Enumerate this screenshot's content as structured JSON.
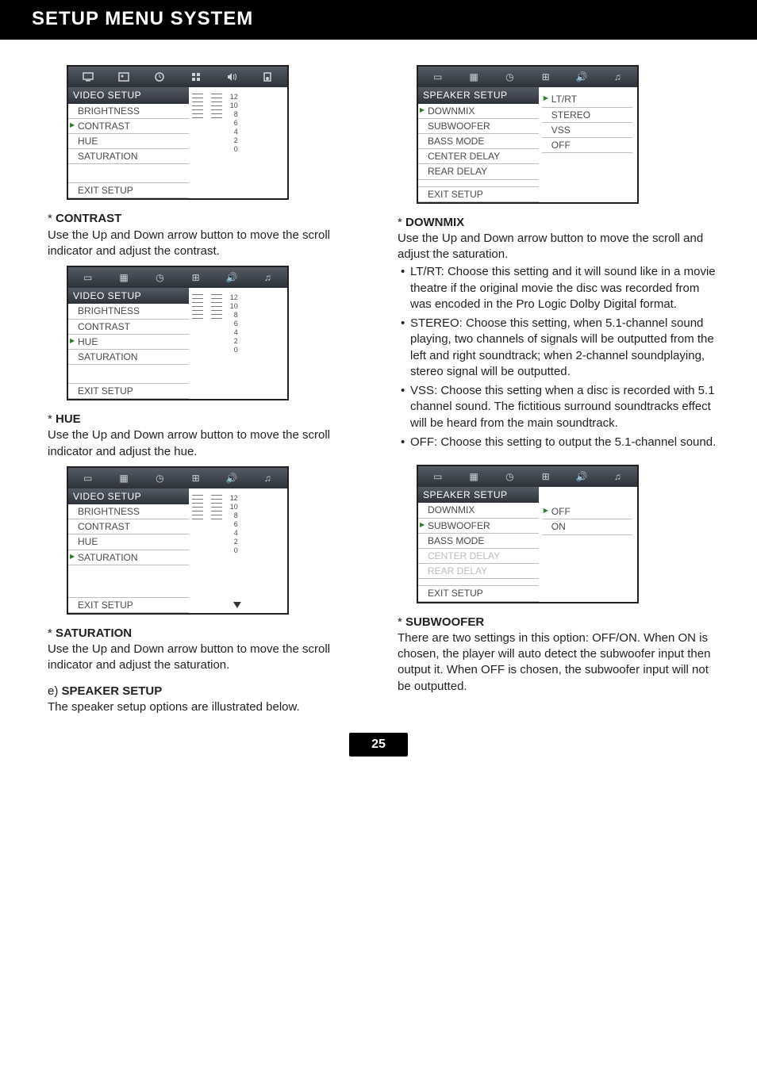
{
  "header": {
    "title": "SETUP MENU SYSTEM"
  },
  "page_number": "25",
  "video_setup": {
    "title": "VIDEO SETUP",
    "items": [
      "BRIGHTNESS",
      "CONTRAST",
      "HUE",
      "SATURATION"
    ],
    "exit": "EXIT SETUP",
    "scale": [
      "12",
      "10",
      "8",
      "6",
      "4",
      "2",
      "0"
    ]
  },
  "speaker_setup_a": {
    "title": "SPEAKER SETUP",
    "items": [
      "DOWNMIX",
      "SUBWOOFER",
      "BASS MODE",
      "CENTER DELAY",
      "REAR DELAY"
    ],
    "exit": "EXIT SETUP",
    "options": [
      "LT/RT",
      "STEREO",
      "VSS",
      "OFF"
    ]
  },
  "speaker_setup_b": {
    "title": "SPEAKER SETUP",
    "items": [
      "DOWNMIX",
      "SUBWOOFER",
      "BASS MODE",
      "CENTER DELAY",
      "REAR DELAY"
    ],
    "exit": "EXIT SETUP",
    "options": [
      "OFF",
      "ON"
    ]
  },
  "left": {
    "contrast_head": "CONTRAST",
    "contrast_body": "Use the Up and Down arrow button to move the scroll indicator and adjust the contrast.",
    "hue_head": "HUE",
    "hue_body": "Use the Up and Down arrow button to move the scroll indicator and adjust the hue.",
    "sat_head": "SATURATION",
    "sat_body": "Use the Up and Down arrow button to move the scroll indicator and adjust the saturation.",
    "speaker_head_prefix": "e) ",
    "speaker_head": "SPEAKER SETUP",
    "speaker_body": "The speaker setup options are illustrated below."
  },
  "right": {
    "downmix_head": "DOWNMIX",
    "downmix_body": "Use the Up and Down arrow button to move the scroll and adjust the saturation.",
    "lt": "LT/RT: Choose this setting and it will sound like in a movie theatre if the original movie the disc was recorded from was encoded in the Pro Logic Dolby Digital format.",
    "stereo": "STEREO: Choose this setting, when 5.1-channel sound playing, two channels of signals will be outputted from the left and right soundtrack; when 2-channel soundplaying, stereo signal will be outputted.",
    "vss": "VSS: Choose this setting when a disc is recorded with 5.1 channel sound. The fictitious surround soundtracks effect will be heard from the main soundtrack.",
    "off": "OFF: Choose this setting to output the 5.1-channel sound.",
    "sub_head": "SUBWOOFER",
    "sub_body": "There are two settings in this option: OFF/ON. When ON is chosen, the player will auto detect the subwoofer input then output it. When OFF is chosen, the subwoofer input will not be outputted."
  }
}
